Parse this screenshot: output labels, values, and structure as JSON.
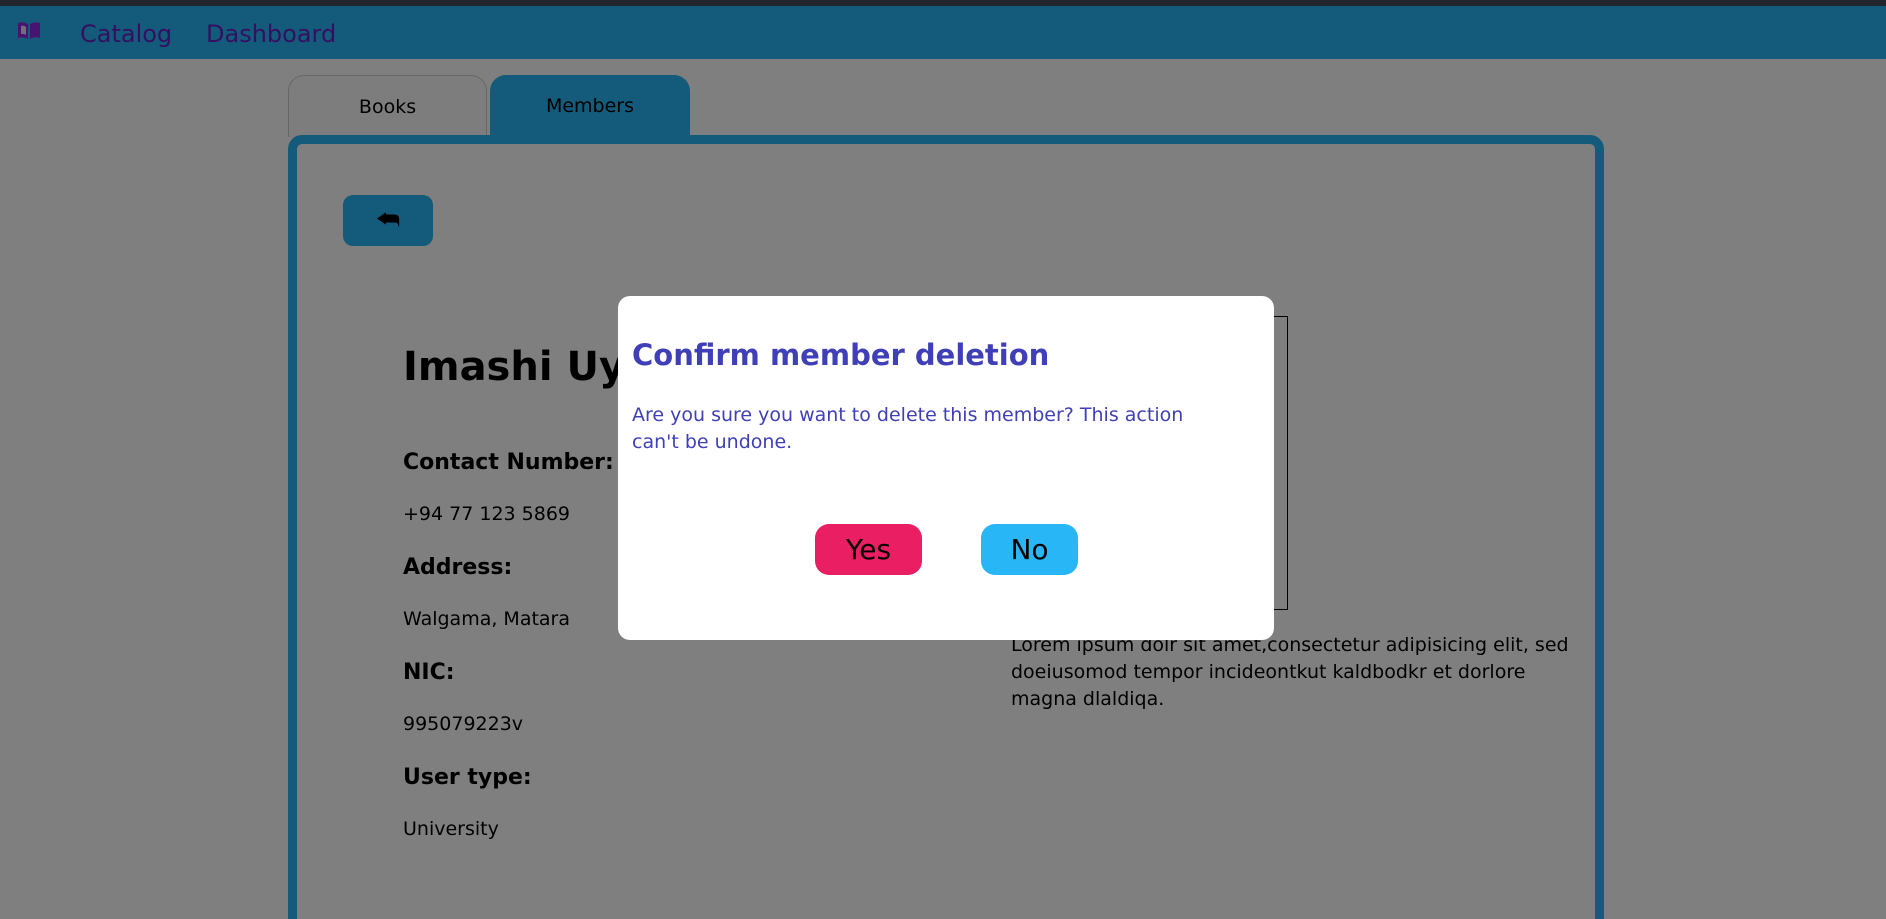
{
  "navbar": {
    "logo_icon": "open-book-icon",
    "links": [
      "Catalog",
      "Dashboard"
    ],
    "background": "#29b6f6",
    "link_color": "#6a1fc2"
  },
  "tabs": [
    {
      "label": "Books",
      "active": false
    },
    {
      "label": "Members",
      "active": true
    }
  ],
  "back_button": {
    "icon": "back-arrow-icon",
    "glyph": "⮪"
  },
  "member": {
    "name": "Imashi Uyar",
    "fields": [
      {
        "label": "Contact Number:",
        "value": "+94 77 123 5869"
      },
      {
        "label": "Address:",
        "value": "Walgama, Matara"
      },
      {
        "label": "NIC:",
        "value": "995079223v"
      },
      {
        "label": "User type:",
        "value": "University"
      }
    ],
    "bio": "Lorem ipsum dolr sit amet,consectetur adipisicing elit, sed doeiusomod tempor incideontkut kaldbodkr et dorlore magna dlaldiqa."
  },
  "modal": {
    "title": "Confirm member deletion",
    "message": "Are you sure you want to delete this member? This action can't be undone.",
    "yes_label": "Yes",
    "no_label": "No",
    "yes_color": "#e91e63",
    "no_color": "#29b6f6"
  }
}
